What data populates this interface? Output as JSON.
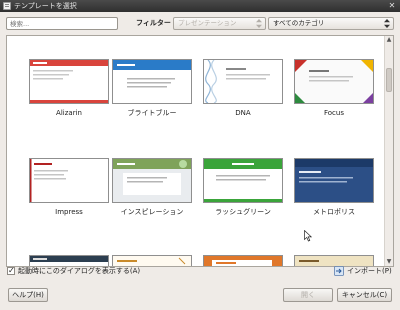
{
  "window": {
    "title": "テンプレートを選択"
  },
  "search": {
    "placeholder": "検索..."
  },
  "filter": {
    "label": "フィルター",
    "type_value": "プレゼンテーション",
    "category_value": "すべてのカテゴリ"
  },
  "templates": [
    {
      "name": "Alizarin",
      "accent": "#d9443c"
    },
    {
      "name": "ブライトブルー",
      "accent": "#2a7bc8"
    },
    {
      "name": "DNA",
      "accent": "#8fb4d6"
    },
    {
      "name": "Focus",
      "accent": "#c8312b"
    },
    {
      "name": "Impress",
      "accent": "#b22222"
    },
    {
      "name": "インスピレーション",
      "accent": "#8bc34a"
    },
    {
      "name": "ラッシュグリーン",
      "accent": "#3aa43a"
    },
    {
      "name": "メトロポリス",
      "accent": "#26508a"
    }
  ],
  "footer": {
    "show_on_startup": "起動時にこのダイアログを表示する(A)",
    "import": "インポート(P)",
    "help": "ヘルプ(H)",
    "open": "開く",
    "cancel": "キャンセル(C)"
  }
}
